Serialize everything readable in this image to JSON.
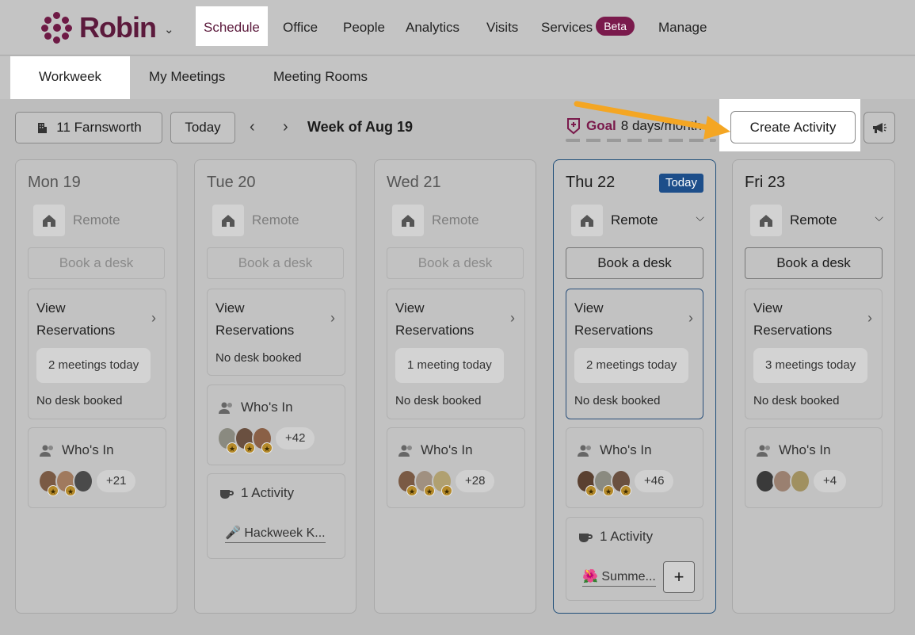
{
  "app": {
    "name": "Robin"
  },
  "nav": {
    "items": [
      "Schedule",
      "Office",
      "People",
      "Analytics",
      "Visits",
      "Services",
      "Manage"
    ],
    "beta": "Beta"
  },
  "subnav": {
    "items": [
      "Workweek",
      "My Meetings",
      "Meeting Rooms"
    ]
  },
  "toolbar": {
    "location": "11 Farnsworth",
    "today": "Today",
    "week": "Week of Aug 19",
    "goal_label": "Goal",
    "goal_value": "8 days/month",
    "create": "Create Activity"
  },
  "days": [
    {
      "label": "Mon 19",
      "remote": "Remote",
      "book": "Book a desk",
      "view": "View",
      "reservations": "Reservations",
      "meetings": "2 meetings today",
      "desk": "No desk booked",
      "who": "Who's In",
      "more": "+21"
    },
    {
      "label": "Tue 20",
      "remote": "Remote",
      "book": "Book a desk",
      "view": "View",
      "reservations": "Reservations",
      "desk": "No desk booked",
      "who": "Who's In",
      "more": "+42",
      "activity": "1 Activity",
      "activity_item": "🎤 Hackweek K..."
    },
    {
      "label": "Wed 21",
      "remote": "Remote",
      "book": "Book a desk",
      "view": "View",
      "reservations": "Reservations",
      "meetings": "1 meeting today",
      "desk": "No desk booked",
      "who": "Who's In",
      "more": "+28"
    },
    {
      "label": "Thu 22",
      "badge": "Today",
      "remote": "Remote",
      "book": "Book a desk",
      "view": "View",
      "reservations": "Reservations",
      "meetings": "2 meetings today",
      "desk": "No desk booked",
      "who": "Who's In",
      "more": "+46",
      "activity": "1 Activity",
      "activity_item": "🌺 Summe..."
    },
    {
      "label": "Fri 23",
      "remote": "Remote",
      "book": "Book a desk",
      "view": "View",
      "reservations": "Reservations",
      "meetings": "3 meetings today",
      "desk": "No desk booked",
      "who": "Who's In",
      "more": "+4"
    }
  ],
  "colors": {
    "brand": "#6e1a45",
    "today": "#1d4e8a",
    "arrow": "#f4a623"
  },
  "icons": [
    "robin-logo-icon",
    "building-icon",
    "chevron-left-icon",
    "chevron-right-icon",
    "goal-shield-icon",
    "megaphone-icon",
    "home-icon",
    "people-icon",
    "coffee-icon",
    "plus-icon"
  ]
}
